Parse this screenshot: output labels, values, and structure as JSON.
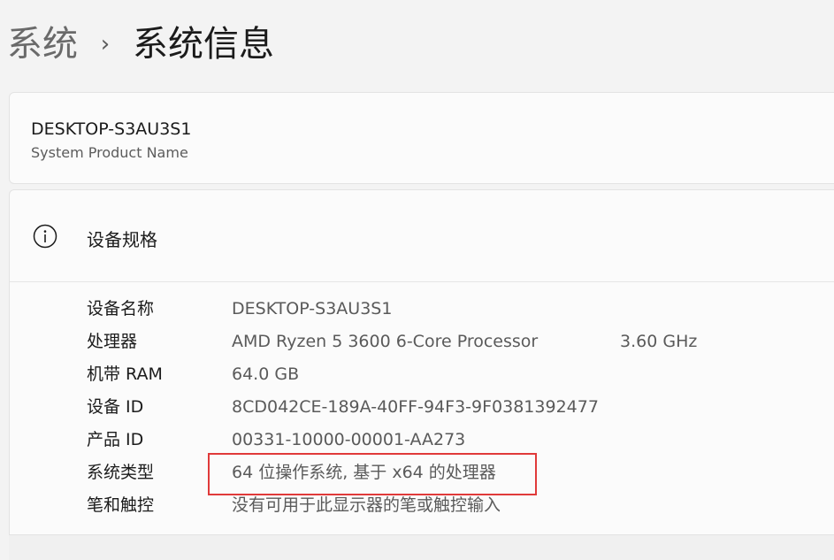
{
  "breadcrumb": {
    "parent": "系统",
    "separator": "›",
    "current": "系统信息"
  },
  "device_card": {
    "name": "DESKTOP-S3AU3S1",
    "model": "System Product Name"
  },
  "specs": {
    "icon": "info-icon",
    "title": "设备规格",
    "rows": [
      {
        "label": "设备名称",
        "value": "DESKTOP-S3AU3S1"
      },
      {
        "label": "处理器",
        "value": "AMD Ryzen 5 3600 6-Core Processor",
        "extra": "3.60 GHz"
      },
      {
        "label": "机带 RAM",
        "value": "64.0 GB"
      },
      {
        "label": "设备 ID",
        "value": "8CD042CE-189A-40FF-94F3-9F0381392477"
      },
      {
        "label": "产品 ID",
        "value": "00331-10000-00001-AA273"
      },
      {
        "label": "系统类型",
        "value": "64 位操作系统, 基于 x64 的处理器"
      },
      {
        "label": "笔和触控",
        "value": "没有可用于此显示器的笔或触控输入"
      }
    ]
  },
  "colors": {
    "highlight": "#e03a3a",
    "background": "#f3f3f3",
    "card": "#fbfbfb"
  }
}
